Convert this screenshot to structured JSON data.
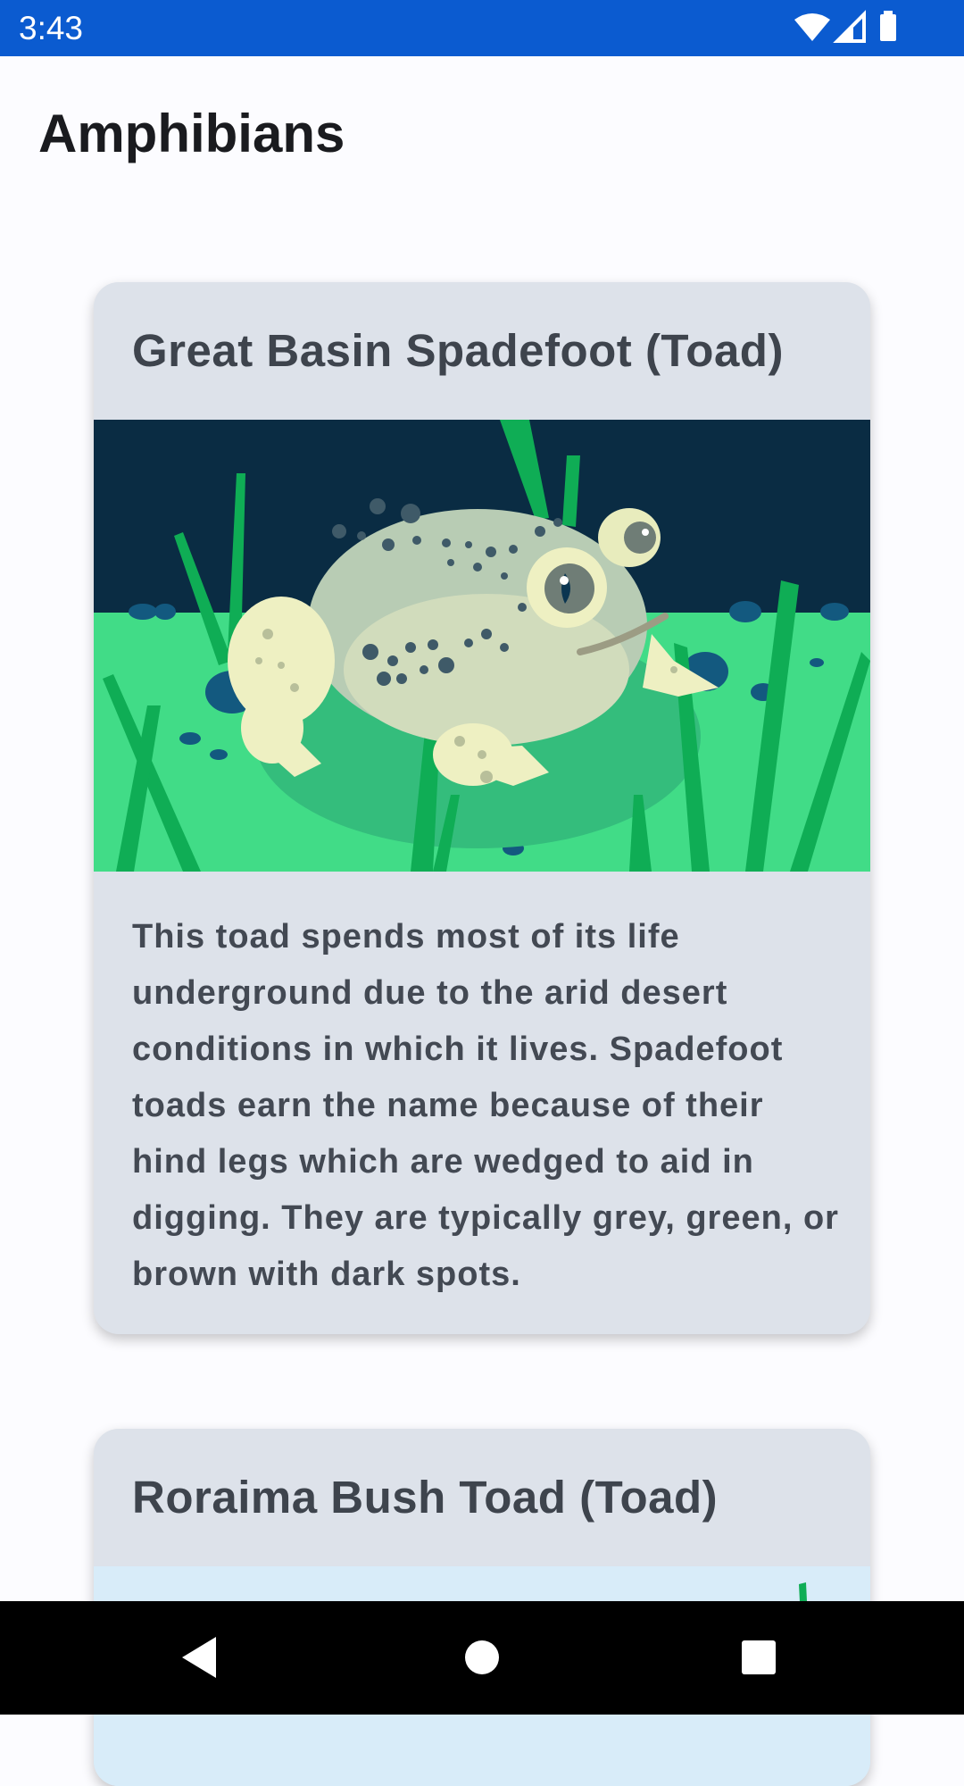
{
  "status_bar": {
    "time": "3:43",
    "icons": [
      "wifi-icon",
      "signal-icon",
      "battery-icon"
    ],
    "background": "#0b5bd0"
  },
  "page": {
    "title": "Amphibians"
  },
  "cards": [
    {
      "title": "Great Basin Spadefoot (Toad)",
      "image": "spadefoot-toad-illustration",
      "description": "This toad spends most of its life underground due to the arid desert conditions in which it lives. Spadefoot toads earn the name because of their hind legs which are wedged to aid in digging. They are typically grey, green, or brown with dark spots."
    },
    {
      "title": "Roraima Bush Toad (Toad)",
      "image": "bush-toad-illustration"
    }
  ],
  "nav_bar": {
    "buttons": [
      "back-icon",
      "home-icon",
      "recents-icon"
    ]
  },
  "colors": {
    "card_background": "#dde2ea",
    "page_background": "#fcfcff",
    "title_text": "#1a1b1f",
    "card_text": "#3e444d"
  }
}
